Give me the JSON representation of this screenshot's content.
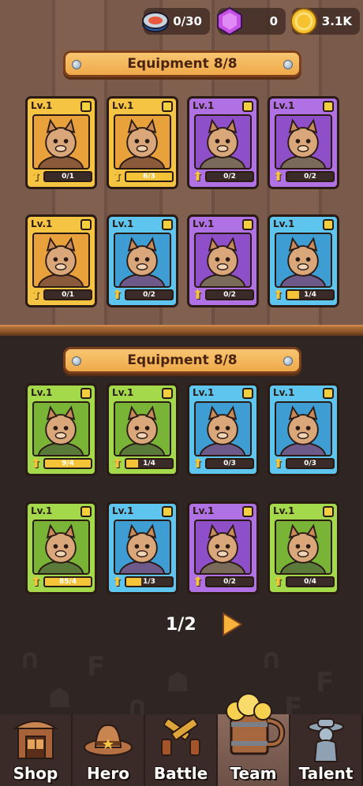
{
  "resources": {
    "tuna": {
      "value": "0/30",
      "icon": "tuna-can-icon"
    },
    "gems": {
      "value": "0",
      "icon": "purple-gem-icon"
    },
    "gold": {
      "value": "3.1K",
      "icon": "gold-coin-icon"
    }
  },
  "sections": [
    {
      "title": "Equipment 8/8",
      "heroes": [
        {
          "level": "Lv.1",
          "progress": "0/1",
          "fill": 0.0,
          "color": "yellow",
          "portrait": "raccoon-knight"
        },
        {
          "level": "Lv.1",
          "progress": "6/3",
          "fill": 1.0,
          "color": "yellow",
          "portrait": "armored-capybara"
        },
        {
          "level": "Lv.1",
          "progress": "0/2",
          "fill": 0.0,
          "color": "purple",
          "portrait": "sunglasses-dog"
        },
        {
          "level": "Lv.1",
          "progress": "0/2",
          "fill": 0.0,
          "color": "purple",
          "portrait": "fox-swordsman"
        },
        {
          "level": "Lv.1",
          "progress": "0/1",
          "fill": 0.0,
          "color": "yellow",
          "portrait": "monkey-king"
        },
        {
          "level": "Lv.1",
          "progress": "0/2",
          "fill": 0.0,
          "color": "blue",
          "portrait": "purple-cow"
        },
        {
          "level": "Lv.1",
          "progress": "0/2",
          "fill": 0.0,
          "color": "purple",
          "portrait": "goose-professor"
        },
        {
          "level": "Lv.1",
          "progress": "1/4",
          "fill": 0.25,
          "color": "blue",
          "portrait": "skunk-sheriff"
        }
      ]
    },
    {
      "title": "Equipment 8/8",
      "heroes": [
        {
          "level": "Lv.1",
          "progress": "9/4",
          "fill": 1.0,
          "color": "green",
          "portrait": "crocodile"
        },
        {
          "level": "Lv.1",
          "progress": "1/4",
          "fill": 0.25,
          "color": "green",
          "portrait": "cigar-dog"
        },
        {
          "level": "Lv.1",
          "progress": "0/3",
          "fill": 0.0,
          "color": "blue",
          "portrait": "lizard-warrior"
        },
        {
          "level": "Lv.1",
          "progress": "0/3",
          "fill": 0.0,
          "color": "blue",
          "portrait": "shark-bandit"
        },
        {
          "level": "Lv.1",
          "progress": "85/4",
          "fill": 1.0,
          "color": "green",
          "portrait": "rabbit-pharaoh"
        },
        {
          "level": "Lv.1",
          "progress": "1/3",
          "fill": 0.33,
          "color": "blue",
          "portrait": "hooded-fox"
        },
        {
          "level": "Lv.1",
          "progress": "0/2",
          "fill": 0.0,
          "color": "purple",
          "portrait": "wizard-goat"
        },
        {
          "level": "Lv.1",
          "progress": "0/4",
          "fill": 0.0,
          "color": "green",
          "portrait": "cap-bear"
        }
      ]
    }
  ],
  "pagination": {
    "text": "1/2",
    "next_icon": "next-arrow-icon"
  },
  "nav": [
    {
      "label": "Shop",
      "icon": "saloon-shop-icon",
      "active": false
    },
    {
      "label": "Hero",
      "icon": "cowboy-hat-icon",
      "active": false
    },
    {
      "label": "Battle",
      "icon": "crossed-revolvers-icon",
      "active": false
    },
    {
      "label": "Team",
      "icon": "beer-mug-icon",
      "active": true
    },
    {
      "label": "Talent",
      "icon": "sheriff-statue-icon",
      "active": false
    }
  ],
  "colors": {
    "yellow": "#f6c443",
    "blue": "#5ec6ee",
    "purple": "#b071e4",
    "green": "#a3d94a",
    "banner": "#f0a94a",
    "progress_fill": "#f5c338"
  }
}
